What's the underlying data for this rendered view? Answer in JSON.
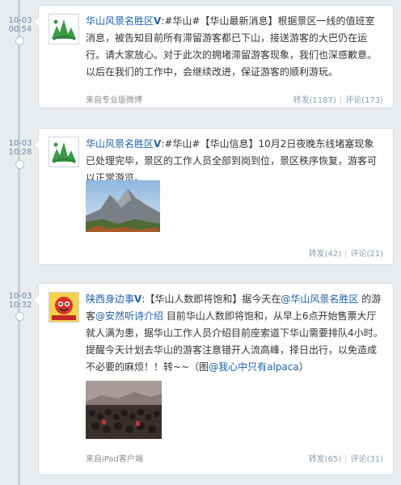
{
  "posts": [
    {
      "date": "10-03",
      "time": "00:54",
      "author": "华山风景名胜区",
      "verified": "V",
      "body": ":#华山#【华山最新消息】根据景区一线的值班室消息，被告知目前所有滞留游客都已下山，接送游客的大巴仍在运行。请大家放心。对于此次的拥堵滞留游客现象，我们也深感歉意。以后在我们的工作中，会继续改进，保证游客的顺利游玩。",
      "source": "来自专业版微博",
      "reposts": "转发(1187)",
      "comments": "评论(173)"
    },
    {
      "date": "10-03",
      "time": "10:28",
      "author": "华山风景名胜区",
      "verified": "V",
      "body": ":#华山#【华山信息】10月2日夜晚东线堵塞现象已处理完毕，景区的工作人员全部到岗到位，景区秩序恢复，游客可以正常游览。",
      "source": "",
      "reposts": "转发(42)",
      "comments": "评论(21)"
    },
    {
      "date": "10-03",
      "time": "10:32",
      "author": "陕西身边事",
      "verified": "V",
      "body_pre": ":【华山人数即将饱和】据今天在",
      "mention1": "@华山风景名胜区",
      "body_mid1": " 的游客",
      "mention2": "@安然听诗介绍",
      "body_mid2": " 目前华山人数即将饱和，从早上6点开始售票大厅就人满为患，据华山工作人员介绍目前座索道下华山需要排队4小时。提醒今天计划去华山的游客注意错开人流高峰，择日出行，以免造成不必要的麻烦！！转~~（图",
      "mention3": "@我心中只有alpaca",
      "body_end": "）",
      "source": "来自iPad客户端",
      "reposts": "转发(65)",
      "comments": "评论(31)"
    }
  ],
  "separator": "|",
  "colors": {
    "link": "#1f62a8",
    "timestamp": "#6d86a6",
    "background": "#e9ecef"
  }
}
